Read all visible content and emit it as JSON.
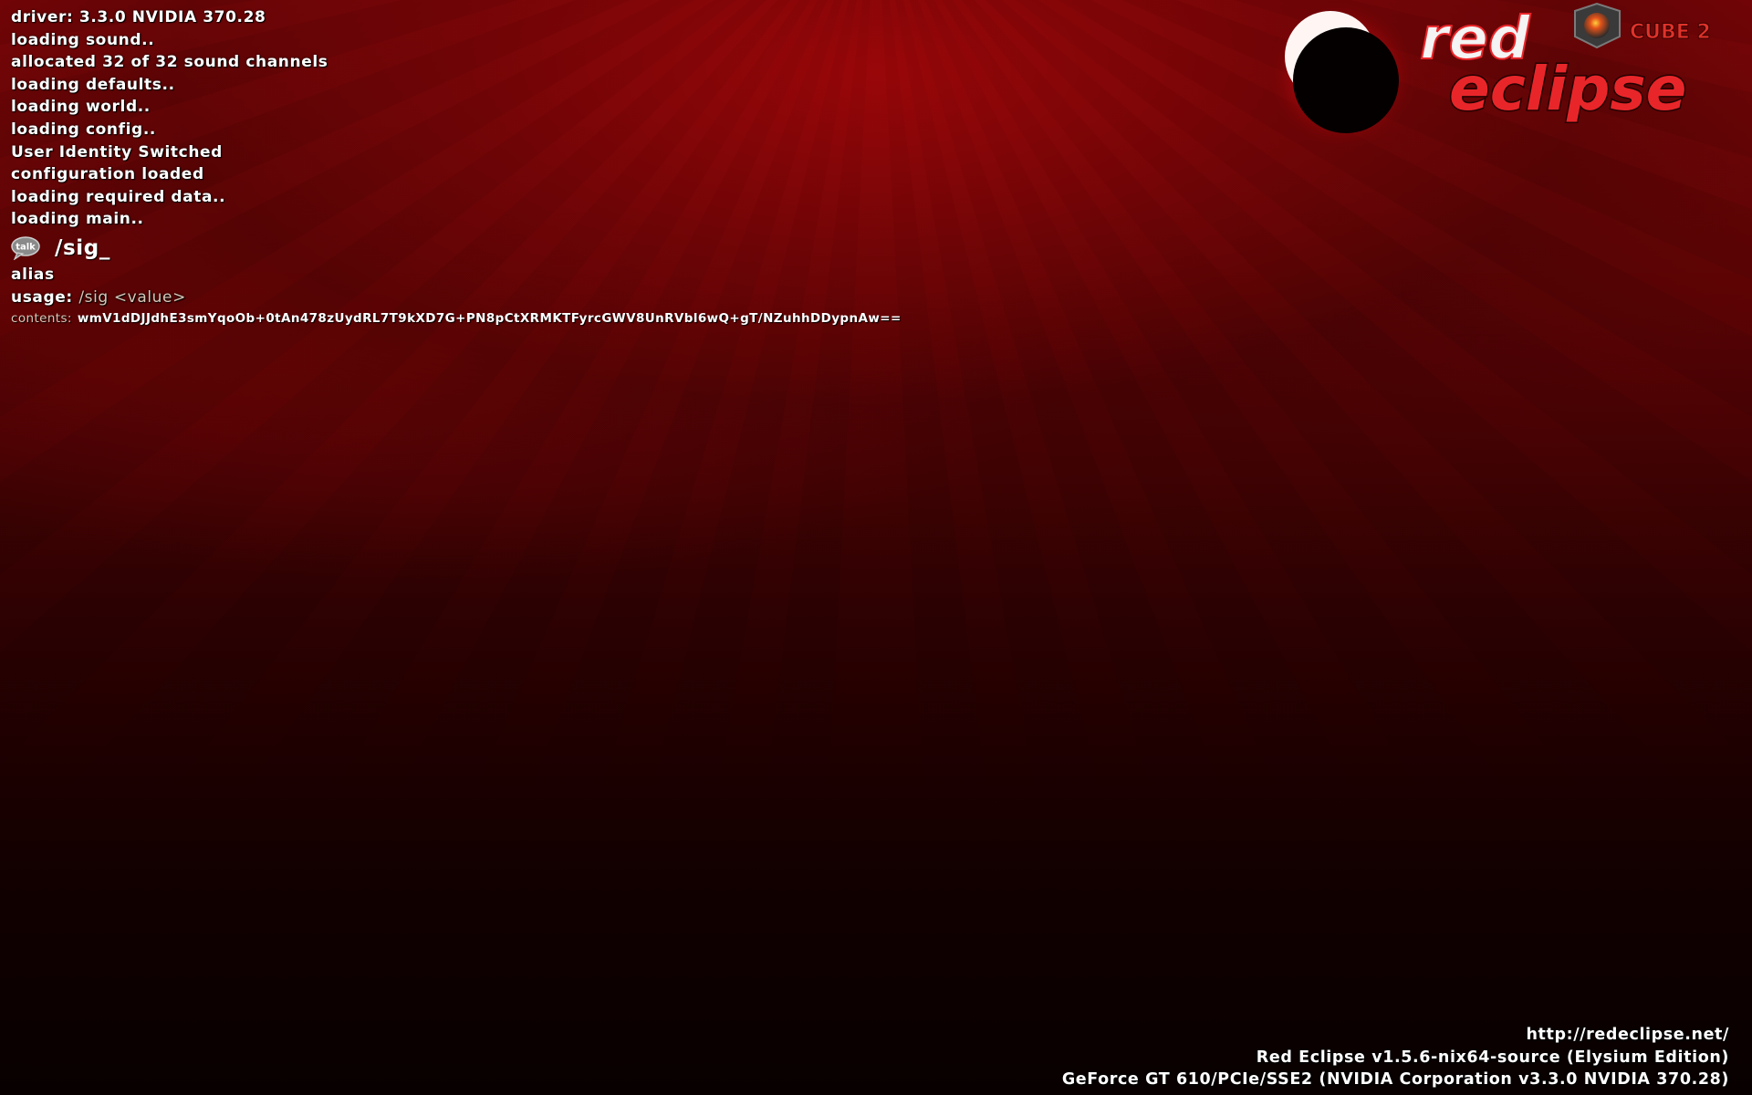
{
  "console": {
    "lines": [
      "driver: 3.3.0 NVIDIA 370.28",
      "loading sound..",
      "allocated 32 of 32 sound channels",
      "loading defaults..",
      "loading world..",
      "loading config..",
      "User Identity Switched",
      "configuration loaded",
      "loading required data..",
      "loading main.."
    ],
    "prompt_icon_label": "talk",
    "prompt_text": "/sig_",
    "alias_line": "alias",
    "usage_label": "usage:",
    "usage_command": "/sig <value>",
    "contents_label": "contents:",
    "contents_value": "wmV1dDJJdhE3smYqoOb+0tAn478zUydRL7T9kXD7G+PN8pCtXRMKTFyrcGWV8UnRVbl6wQ+gT/NZuhhDDypnAw=="
  },
  "logo": {
    "title_line1": "red",
    "title_line2": "eclipse",
    "badge": "CUBE 2"
  },
  "footer": {
    "url": "http://redeclipse.net/",
    "version": "Red Eclipse v1.5.6-nix64-source (Elysium Edition)",
    "renderer": "GeForce GT 610/PCIe/SSE2 (NVIDIA Corporation v3.3.0 NVIDIA 370.28)"
  },
  "colors": {
    "background_top": "#7a0507",
    "background_bottom": "#080000",
    "text": "#ffffff",
    "muted_text": "#d7c8b8",
    "logo_red": "#e8262a"
  }
}
